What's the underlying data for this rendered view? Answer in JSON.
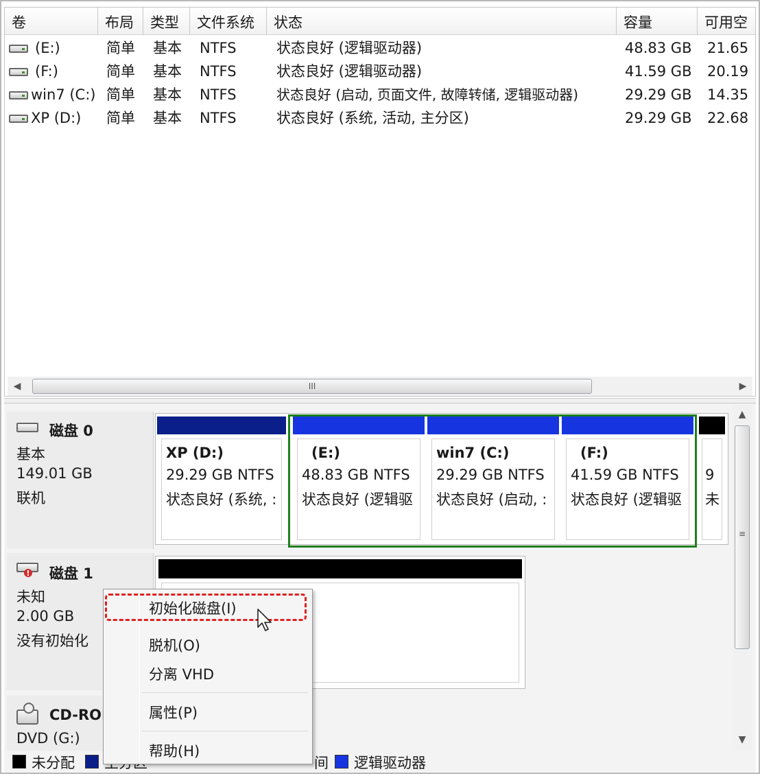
{
  "columns": [
    "卷",
    "布局",
    "类型",
    "文件系统",
    "状态",
    "容量",
    "可用空"
  ],
  "volumes": [
    {
      "name": "(E:)",
      "layout": "简单",
      "type": "基本",
      "fs": "NTFS",
      "status": "状态良好 (逻辑驱动器)",
      "capacity": "48.83 GB",
      "free": "21.65"
    },
    {
      "name": "(F:)",
      "layout": "简单",
      "type": "基本",
      "fs": "NTFS",
      "status": "状态良好 (逻辑驱动器)",
      "capacity": "41.59 GB",
      "free": "20.19"
    },
    {
      "name": "win7 (C:)",
      "layout": "简单",
      "type": "基本",
      "fs": "NTFS",
      "status": "状态良好 (启动, 页面文件, 故障转储, 逻辑驱动器)",
      "capacity": "29.29 GB",
      "free": "14.35"
    },
    {
      "name": "XP (D:)",
      "layout": "简单",
      "type": "基本",
      "fs": "NTFS",
      "status": "状态良好 (系统, 活动, 主分区)",
      "capacity": "29.29 GB",
      "free": "22.68"
    }
  ],
  "hscroll_grip": "III",
  "vscroll_grip": "≡",
  "disk0": {
    "title": "磁盘 0",
    "type": "基本",
    "size": "149.01 GB",
    "state": "联机",
    "partitions": [
      {
        "label": "XP  (D:)",
        "size": "29.29 GB NTFS",
        "status": "状态良好 (系统, :",
        "band": "#0a1f8a"
      },
      {
        "label": "(E:)",
        "size": "48.83 GB NTFS",
        "status": "状态良好 (逻辑驱",
        "band": "#1635e0"
      },
      {
        "label": "win7  (C:)",
        "size": "29.29 GB NTFS",
        "status": "状态良好 (启动, :",
        "band": "#1635e0"
      },
      {
        "label": "(F:)",
        "size": "41.59 GB NTFS",
        "status": "状态良好 (逻辑驱",
        "band": "#1635e0"
      },
      {
        "label": "9",
        "size": "",
        "status": "未",
        "band": "#000000"
      }
    ]
  },
  "disk1": {
    "title": "磁盘 1",
    "type": "未知",
    "size": "2.00 GB",
    "state": "没有初始化"
  },
  "cdrom": {
    "title": "CD-ROM",
    "drive": "DVD (G:)"
  },
  "legend": [
    {
      "label": "未分配",
      "color": "#000000"
    },
    {
      "label": "主分区",
      "color": "#0a1f8a"
    },
    {
      "label": "逻辑驱动器",
      "color": "#1635e0"
    }
  ],
  "legend_partial": "间",
  "context_menu": {
    "items": [
      "初始化磁盘(I)",
      "脱机(O)",
      "分离 VHD",
      "属性(P)",
      "帮助(H)"
    ],
    "highlight_color": "#e02020"
  },
  "colors": {
    "selection_outline": "#1e7f1e",
    "unallocated": "#000000",
    "primary": "#0a1f8a",
    "logical": "#1635e0"
  }
}
